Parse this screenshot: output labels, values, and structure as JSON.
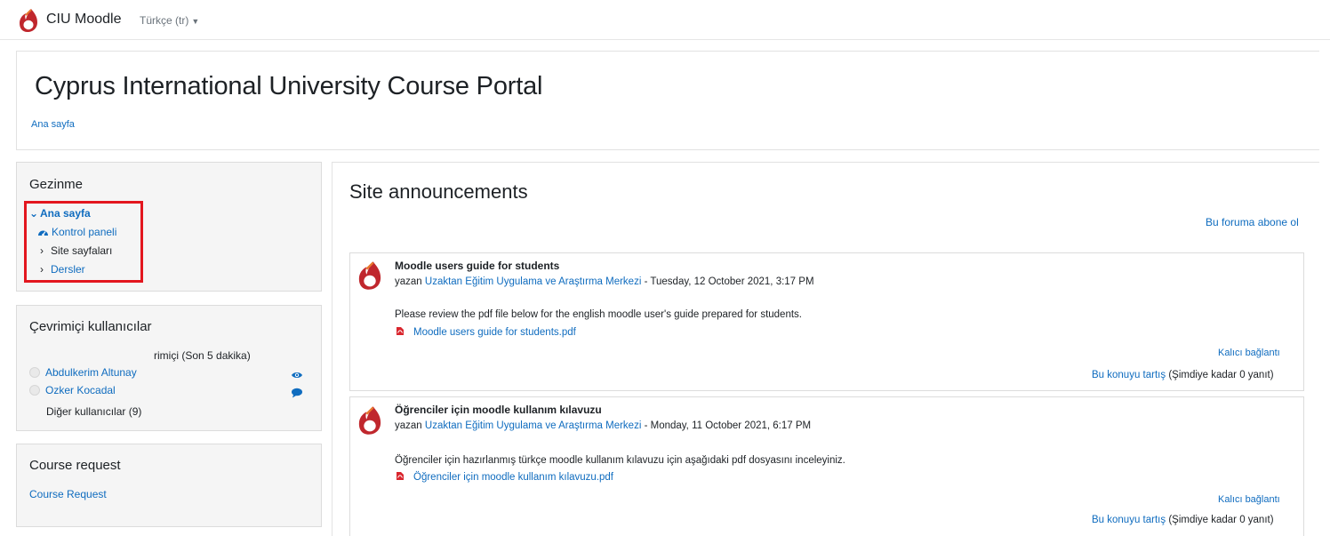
{
  "navbar": {
    "site_name": "CIU Moodle",
    "language": "Türkçe (tr)",
    "caret_icon": "caret-down-icon",
    "logo_icon": "moodle-flame-logo",
    "logo_color": "#c0272d"
  },
  "header": {
    "title": "Cyprus International University Course Portal",
    "breadcrumb": "Ana sayfa"
  },
  "navigation_block": {
    "title": "Gezinme",
    "items": [
      {
        "label": "Ana sayfa",
        "icon": "chevron-down-icon",
        "expanded": true
      },
      {
        "label": "Kontrol paneli",
        "icon": "dashboard-icon"
      },
      {
        "label": "Site sayfaları",
        "icon": "chevron-right-icon"
      },
      {
        "label": "Dersler",
        "icon": "chevron-right-icon"
      }
    ],
    "highlight_color": "#e3161e"
  },
  "online_users_block": {
    "title": "Çevrimiçi kullanıcılar",
    "status": "rimiçi (Son 5 dakika)",
    "users": [
      {
        "name": "Abdulkerim Altunay",
        "action_icon": "eye-icon"
      },
      {
        "name": "Ozker Kocadal",
        "action_icon": "message-icon"
      }
    ],
    "others": "Diğer kullanıcılar (9)"
  },
  "course_request_block": {
    "title": "Course request",
    "link": "Course Request"
  },
  "main": {
    "title": "Site announcements",
    "subscribe": "Bu foruma abone ol",
    "posts": [
      {
        "subject": "Moodle users guide for students",
        "by_prefix": "yazan",
        "author": "Uzaktan Eğitim Uygulama ve Araştırma Merkezi",
        "date": "- Tuesday, 12 October 2021, 3:17 PM",
        "message": "Please review the pdf file below for the english moodle user's guide prepared for students.",
        "attachment": "Moodle users guide for students.pdf",
        "permalink": "Kalıcı bağlantı",
        "discuss": "Bu konuyu tartış",
        "replies": "(Şimdiye kadar 0 yanıt)"
      },
      {
        "subject": "Öğrenciler için moodle kullanım kılavuzu",
        "by_prefix": "yazan",
        "author": "Uzaktan Eğitim Uygulama ve Araştırma Merkezi",
        "date": "- Monday, 11 October 2021, 6:17 PM",
        "message": "Öğrenciler için hazırlanmış türkçe moodle kullanım kılavuzu için aşağıdaki pdf dosyasını inceleyiniz.",
        "attachment": "Öğrenciler için moodle kullanım kılavuzu.pdf",
        "permalink": "Kalıcı bağlantı",
        "discuss": "Bu konuyu tartış",
        "replies": "(Şimdiye kadar 0 yanıt)"
      }
    ]
  },
  "colors": {
    "link": "#0f6cbf",
    "text": "#1d2125",
    "pdf": "#d9262e"
  }
}
